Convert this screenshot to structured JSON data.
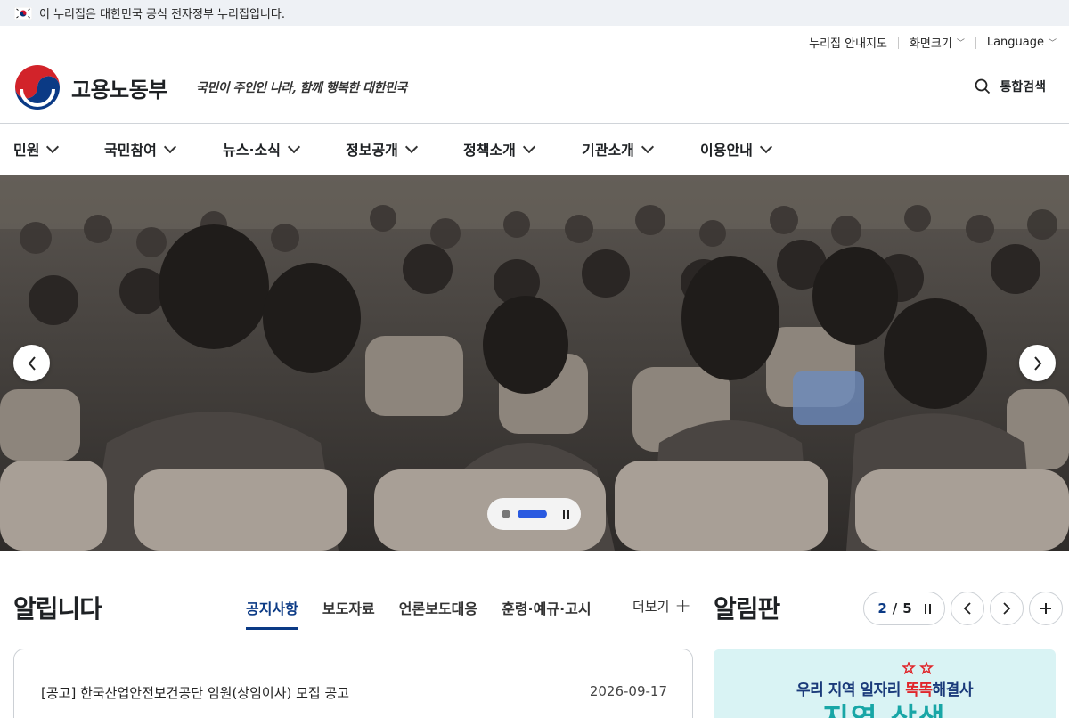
{
  "gov_banner": {
    "text": "이 누리집은 대한민국 공식 전자정부 누리집입니다."
  },
  "utility": {
    "sitemap": "누리집 안내지도",
    "font_size": "화면크기",
    "language": "Language"
  },
  "header": {
    "ministry_name": "고용노동부",
    "slogan": "국민이 주인인 나라, 함께 행복한 대한민국",
    "search_label": "통합검색"
  },
  "gnb": [
    "민원",
    "국민참여",
    "뉴스·소식",
    "정보공개",
    "정책소개",
    "기관소개",
    "이용안내"
  ],
  "hero": {
    "slide_count": 2,
    "active_slide": 2
  },
  "notices": {
    "title": "알립니다",
    "tabs": [
      "공지사항",
      "보도자료",
      "언론보도대응",
      "훈령·예규·고시"
    ],
    "active_tab": 0,
    "more_label": "더보기",
    "items": [
      {
        "title": "[공고] 한국산업안전보건공단 임원(상임이사) 모집 공고",
        "date": "2026-09-17"
      }
    ]
  },
  "board": {
    "title": "알림판",
    "current": "2",
    "separator": "/",
    "total": "5",
    "banner_line_pre": "우리 지역 일자리 ",
    "banner_line_red": "똑똑",
    "banner_line_post": "해결사",
    "banner_big": "지역 상생"
  },
  "colors": {
    "accent": "#0b3a85",
    "indicator": "#2a5ae0",
    "banner_bg": "#d9f3f4"
  }
}
